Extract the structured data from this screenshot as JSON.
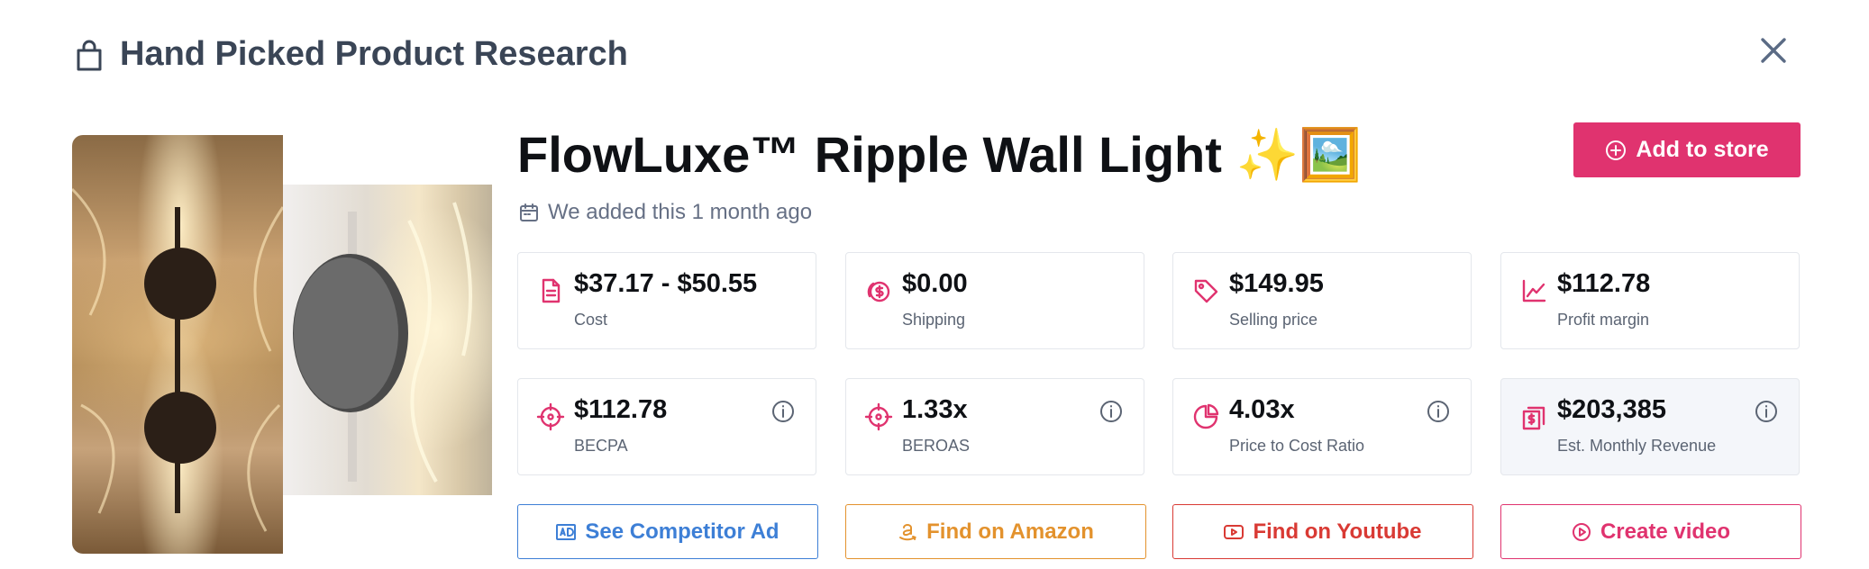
{
  "header": {
    "title": "Hand Picked Product Research",
    "icon": "shopping-bag-icon",
    "close_icon": "close-icon"
  },
  "product": {
    "title": "FlowLuxe™ Ripple Wall Light ✨🖼️",
    "added_text": "We added this 1 month ago",
    "add_to_store_label": "Add to store"
  },
  "stats": [
    {
      "value": "$37.17 - $50.55",
      "label": "Cost",
      "icon": "document-icon"
    },
    {
      "value": "$0.00",
      "label": "Shipping",
      "icon": "coins-icon"
    },
    {
      "value": "$149.95",
      "label": "Selling price",
      "icon": "price-tag-icon"
    },
    {
      "value": "$112.78",
      "label": "Profit margin",
      "icon": "line-chart-icon"
    },
    {
      "value": "$112.78",
      "label": "BECPA",
      "icon": "crosshair-icon",
      "info": true
    },
    {
      "value": "1.33x",
      "label": "BEROAS",
      "icon": "crosshair-icon",
      "info": true
    },
    {
      "value": "4.03x",
      "label": "Price to Cost Ratio",
      "icon": "pie-chart-icon",
      "info": true
    },
    {
      "value": "$203,385",
      "label": "Est. Monthly Revenue",
      "icon": "receipt-icon",
      "info": true
    }
  ],
  "actions": {
    "competitor_ad": "See Competitor Ad",
    "amazon": "Find on Amazon",
    "youtube": "Find on Youtube",
    "create_video": "Create video"
  },
  "colors": {
    "accent": "#e0336f",
    "blue": "#3d7fd6",
    "amber": "#e3922d",
    "red": "#d93a34",
    "muted_text": "#667085"
  }
}
